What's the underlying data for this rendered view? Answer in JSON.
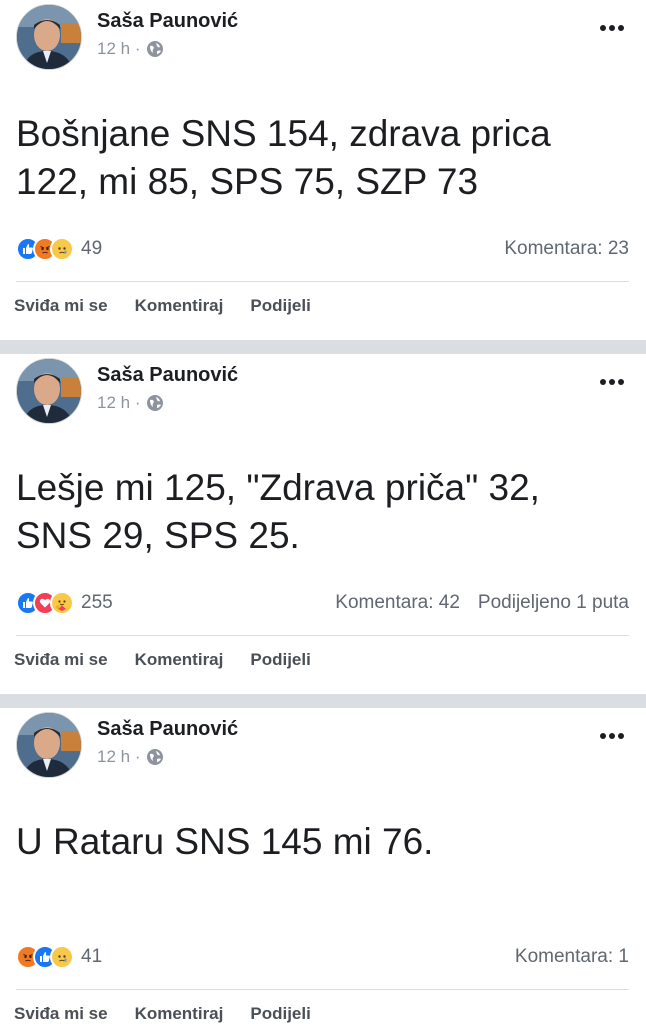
{
  "posts": [
    {
      "author": "Saša Paunović",
      "time": "12 h",
      "dot": "·",
      "text": "Bošnjane SNS 154, zdrava prica 122, mi 85, SPS 75, SZP 73",
      "reactions": [
        "like",
        "angry",
        "sad"
      ],
      "reaction_count": "49",
      "comments": "Komentara: 23",
      "shares": ""
    },
    {
      "author": "Saša Paunović",
      "time": "12 h",
      "dot": "·",
      "text": "Lešje mi 125, \"Zdrava priča\" 32, SNS 29, SPS 25.",
      "reactions": [
        "like",
        "love",
        "care"
      ],
      "reaction_count": "255",
      "comments": "Komentara: 42",
      "shares": "Podijeljeno 1 puta"
    },
    {
      "author": "Saša Paunović",
      "time": "12 h",
      "dot": "·",
      "text": "U Rataru SNS 145 mi 76.",
      "reactions": [
        "angry",
        "like",
        "sad"
      ],
      "reaction_count": "41",
      "comments": "Komentara: 1",
      "shares": ""
    }
  ],
  "actions": {
    "like": "Sviđa mi se",
    "comment": "Komentiraj",
    "share": "Podijeli"
  },
  "icons": {
    "more": "more-horizontal-icon",
    "globe": "globe-icon",
    "avatar": "profile-photo"
  },
  "colors": {
    "like": "#1877f2",
    "love": "#f33e58",
    "angry": "#f07a21",
    "sad": "#f7c94a",
    "divider": "#dadde1"
  }
}
